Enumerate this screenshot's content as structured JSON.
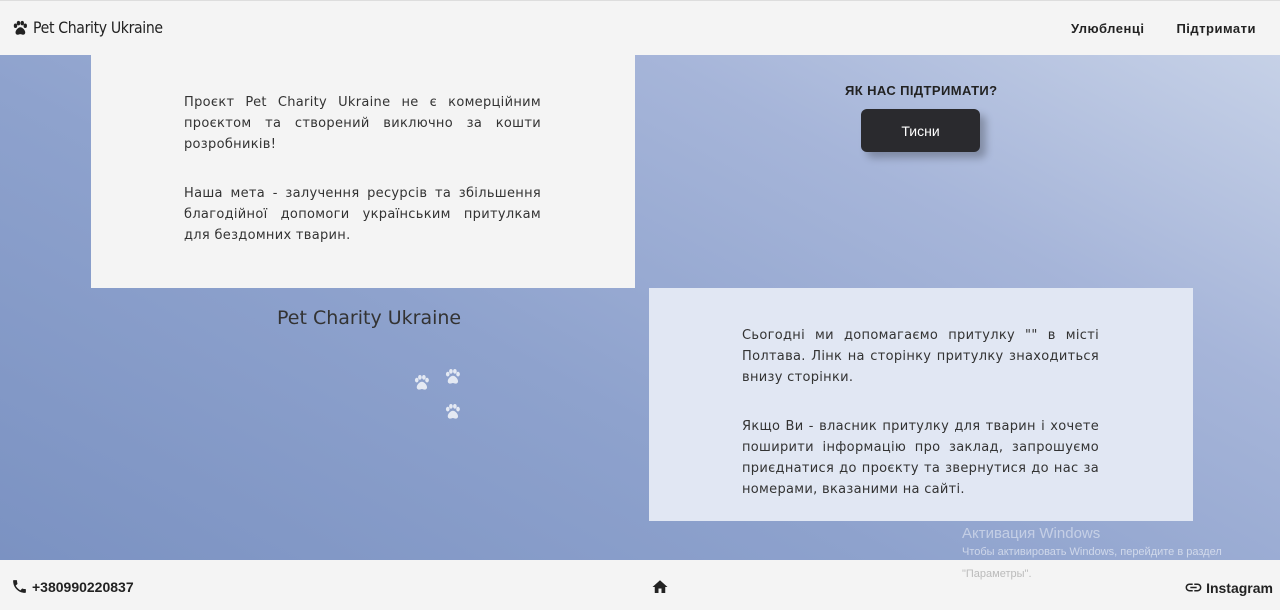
{
  "navbar": {
    "brand": "Pet Charity Ukraine",
    "brand_icon": "paw-icon",
    "links": [
      "Улюбленці",
      "Підтримати"
    ]
  },
  "card1": {
    "p1": "Проєкт Pet Charity Ukraine не є комерційним проєктом та створений виключно за кошти розробників!",
    "p2": "Наша мета - залучення ресурсів та збільшення благодійної допомоги українським притулкам для бездомних тварин."
  },
  "support": {
    "title": "ЯК НАС ПІДТРИМАТИ?",
    "button": "Тисни"
  },
  "center_brand": "Pet Charity Ukraine",
  "card2": {
    "p1": "Сьогодні ми допомагаємо притулку \"\" в місті Полтава. Лінк на сторінку притулку знаходиться внизу сторінки.",
    "p2": "Якщо Ви - власник притулку для тварин і хочете поширити інформацію про заклад, запрошуємо приєднатися до проєкту та звернутися до нас за номерами, вказаними на сайті."
  },
  "watermark": {
    "title": "Активация Windows",
    "line1": "Чтобы активировать Windows, перейдите в раздел",
    "line2": "\"Параметры\"."
  },
  "footer": {
    "phone": "+380990220837",
    "phone_icon": "phone-icon",
    "home_icon": "home-icon",
    "instagram": "Instagram",
    "link_icon": "link-icon"
  },
  "colors": {
    "bg_gradient_start": "#7b92c2",
    "bg_gradient_end": "#c6d1e7",
    "card_light": "#f4f4f4",
    "card_blue": "#e1e7f3",
    "button_dark": "#2a2a2e"
  }
}
